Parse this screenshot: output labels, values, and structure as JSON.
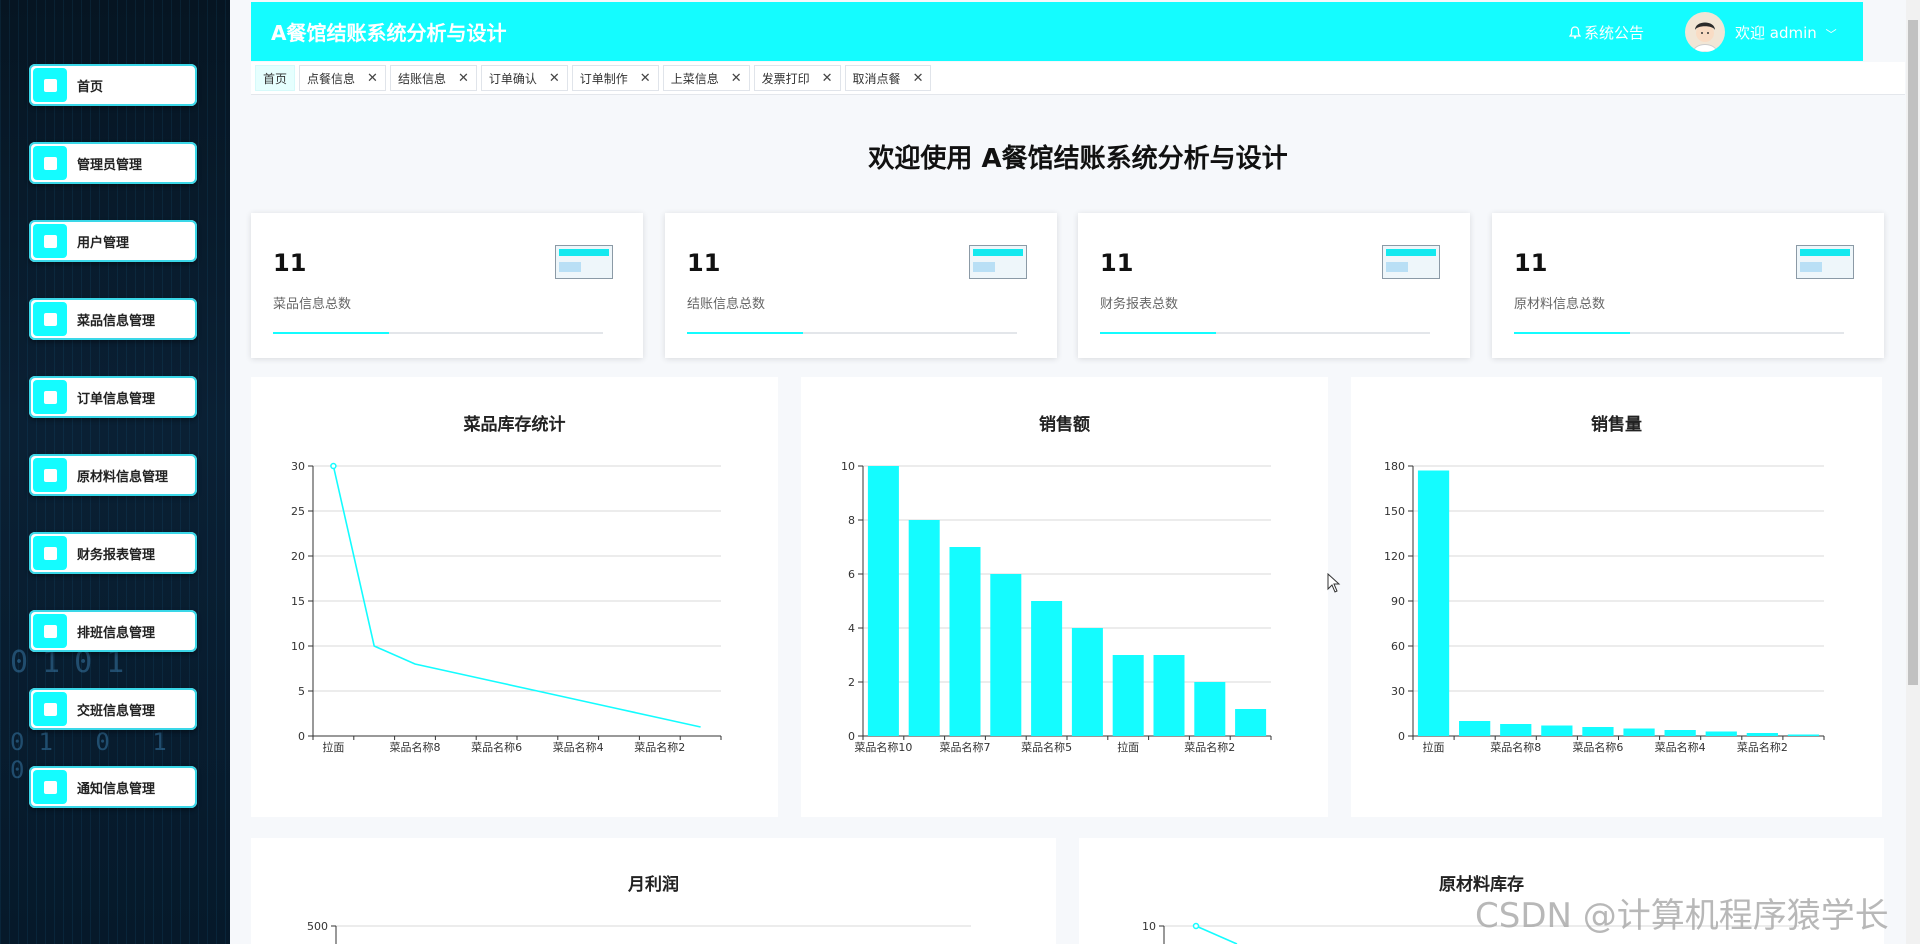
{
  "sidebar": {
    "items": [
      {
        "label": "首页",
        "icon": "home-icon"
      },
      {
        "label": "管理员管理",
        "icon": "doc-icon"
      },
      {
        "label": "用户管理",
        "icon": "user-icon"
      },
      {
        "label": "菜品信息管理",
        "icon": "grid-icon"
      },
      {
        "label": "订单信息管理",
        "icon": "doc-icon"
      },
      {
        "label": "原材料信息管理",
        "icon": "briefcase-icon"
      },
      {
        "label": "财务报表管理",
        "icon": "home-icon"
      },
      {
        "label": "排班信息管理",
        "icon": "doc-icon"
      },
      {
        "label": "交班信息管理",
        "icon": "circle-icon"
      },
      {
        "label": "通知信息管理",
        "icon": "doc-icon"
      }
    ],
    "decor_binary": [
      "0101",
      "01 0 1 0"
    ]
  },
  "header": {
    "title": "A餐馆结账系统分析与设计",
    "notice": "系统公告",
    "welcome": "欢迎 admin",
    "accent": "#14fcff"
  },
  "tabs": [
    {
      "label": "首页",
      "closable": false
    },
    {
      "label": "点餐信息",
      "closable": true
    },
    {
      "label": "结账信息",
      "closable": true
    },
    {
      "label": "订单确认",
      "closable": true
    },
    {
      "label": "订单制作",
      "closable": true
    },
    {
      "label": "上菜信息",
      "closable": true
    },
    {
      "label": "发票打印",
      "closable": true
    },
    {
      "label": "取消点餐",
      "closable": true
    }
  ],
  "tab_close_glyph": "✕",
  "main": {
    "welcome_title": "欢迎使用 A餐馆结账系统分析与设计",
    "stats": [
      {
        "value": "11",
        "label": "菜品信息总数",
        "progress": 0.35
      },
      {
        "value": "11",
        "label": "结账信息总数",
        "progress": 0.35
      },
      {
        "value": "11",
        "label": "财务报表总数",
        "progress": 0.35
      },
      {
        "value": "11",
        "label": "原材料信息总数",
        "progress": 0.35
      }
    ]
  },
  "chart_data": [
    {
      "type": "line",
      "title": "菜品库存统计",
      "tick_labels": [
        "拉面",
        "菜品名称8",
        "菜品名称6",
        "菜品名称4",
        "菜品名称2"
      ],
      "values": [
        30,
        10,
        8,
        7,
        6,
        5,
        4,
        3,
        2,
        1
      ],
      "ylim": [
        0,
        30
      ],
      "yticks": [
        0,
        5,
        10,
        15,
        20,
        25,
        30
      ],
      "color": "#14fcff"
    },
    {
      "type": "bar",
      "title": "销售额",
      "tick_labels": [
        "菜品名称10",
        "菜品名称7",
        "菜品名称5",
        "拉面",
        "菜品名称2"
      ],
      "values": [
        10,
        8,
        7,
        6,
        5,
        4,
        3,
        3,
        2,
        1
      ],
      "ylim": [
        0,
        10
      ],
      "yticks": [
        0,
        2,
        4,
        6,
        8,
        10
      ],
      "color": "#14fcff"
    },
    {
      "type": "bar",
      "title": "销售量",
      "tick_labels": [
        "拉面",
        "菜品名称8",
        "菜品名称6",
        "菜品名称4",
        "菜品名称2"
      ],
      "values": [
        177,
        10,
        8,
        7,
        6,
        5,
        4,
        3,
        2,
        1
      ],
      "ylim": [
        0,
        180
      ],
      "yticks": [
        0,
        30,
        60,
        90,
        120,
        150,
        180
      ],
      "color": "#14fcff"
    },
    {
      "type": "line",
      "title": "月利润",
      "yticks_visible": [
        500
      ],
      "color": "#14fcff"
    },
    {
      "type": "line",
      "title": "原材料库存",
      "yticks_visible": [
        10
      ],
      "first_value": 10,
      "color": "#14fcff"
    }
  ],
  "watermark": "CSDN @计算机程序猿学长"
}
